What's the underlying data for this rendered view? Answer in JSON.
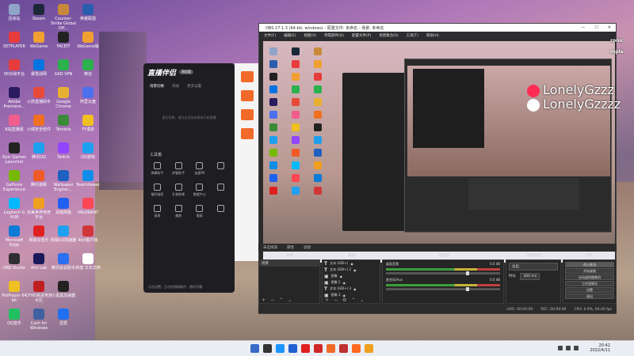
{
  "desktop": {
    "icons": [
      {
        "label": "回收站",
        "color": "#8fa4c8",
        "col": 0,
        "row": 0
      },
      {
        "label": "Steam",
        "color": "#1b2838",
        "col": 1,
        "row": 0
      },
      {
        "label": "Counter-Strike Global Off...",
        "color": "#c88a3a",
        "col": 2,
        "row": 0
      },
      {
        "label": "英雄联盟",
        "color": "#2a5db0",
        "col": 3,
        "row": 0
      },
      {
        "label": "5ETPLAYER",
        "color": "#e63c3c",
        "col": 0,
        "row": 1
      },
      {
        "label": "WeGame",
        "color": "#f0a030",
        "col": 1,
        "row": 1
      },
      {
        "label": "FACEIT",
        "color": "#222222",
        "col": 2,
        "row": 1
      },
      {
        "label": "WeGame版",
        "color": "#f0a030",
        "col": 3,
        "row": 1
      },
      {
        "label": "5E对战平台",
        "color": "#e63c3c",
        "col": 0,
        "row": 2
      },
      {
        "label": "暴雪战网",
        "color": "#0074e0",
        "col": 1,
        "row": 2
      },
      {
        "label": "GKD VPN",
        "color": "#2bb24c",
        "col": 2,
        "row": 2
      },
      {
        "label": "微信",
        "color": "#2bb24c",
        "col": 3,
        "row": 2
      },
      {
        "label": "Adobe Premiere...",
        "color": "#2a1a5e",
        "col": 0,
        "row": 3
      },
      {
        "label": "火箭直播助手",
        "color": "#e84a3a",
        "col": 1,
        "row": 3
      },
      {
        "label": "Google Chrome",
        "color": "#e8b030",
        "col": 2,
        "row": 3
      },
      {
        "label": "阿里云盘",
        "color": "#4a70f0",
        "col": 3,
        "row": 3
      },
      {
        "label": "B站直播姬",
        "color": "#f25d8e",
        "col": 0,
        "row": 4
      },
      {
        "label": "火绒安全软件",
        "color": "#f07020",
        "col": 1,
        "row": 4
      },
      {
        "label": "Terraria",
        "color": "#3a8a3a",
        "col": 2,
        "row": 4
      },
      {
        "label": "YY语音",
        "color": "#f0c020",
        "col": 3,
        "row": 4
      },
      {
        "label": "Epic Games Launcher",
        "color": "#222222",
        "col": 0,
        "row": 5
      },
      {
        "label": "腾讯QQ",
        "color": "#1ea0f0",
        "col": 1,
        "row": 5
      },
      {
        "label": "Twitch",
        "color": "#9146ff",
        "col": 2,
        "row": 5
      },
      {
        "label": "QQ游戏",
        "color": "#1ea0f0",
        "col": 3,
        "row": 5
      },
      {
        "label": "GeForce Experience",
        "color": "#76b900",
        "col": 0,
        "row": 6
      },
      {
        "label": "腾讯视频",
        "color": "#f05a28",
        "col": 1,
        "row": 6
      },
      {
        "label": "Wallpaper Engine:...",
        "color": "#2060c0",
        "col": 2,
        "row": 6
      },
      {
        "label": "TeamViewer",
        "color": "#0e8ee9",
        "col": 3,
        "row": 6
      },
      {
        "label": "Logitech G HUB",
        "color": "#00b8fc",
        "col": 0,
        "row": 7
      },
      {
        "label": "完美世界电竞平台",
        "color": "#f0a020",
        "col": 1,
        "row": 7
      },
      {
        "label": "百度网盘",
        "color": "#2060f0",
        "col": 2,
        "row": 7
      },
      {
        "label": "VALORANT",
        "color": "#ff4655",
        "col": 3,
        "row": 7
      },
      {
        "label": "Microsoft Edge",
        "color": "#0a7bd8",
        "col": 0,
        "row": 8
      },
      {
        "label": "网易云音乐",
        "color": "#e02020",
        "col": 1,
        "row": 8
      },
      {
        "label": "网易UU加速器",
        "color": "#20a0f0",
        "col": 2,
        "row": 8
      },
      {
        "label": "Riot客户端",
        "color": "#d13639",
        "col": 3,
        "row": 8
      },
      {
        "label": "OBS Studio",
        "color": "#302e31",
        "col": 0,
        "row": 9
      },
      {
        "label": "Aim Lab",
        "color": "#1a1a5a",
        "col": 1,
        "row": 9
      },
      {
        "label": "腾讯会议助手",
        "color": "#2a70f0",
        "col": 2,
        "row": 9
      },
      {
        "label": "新建 文本文档",
        "color": "#ffffff",
        "col": 3,
        "row": 9
      },
      {
        "label": "PotPlayer 64 bit",
        "color": "#f0c020",
        "col": 0,
        "row": 10
      },
      {
        "label": "CFHD高清竞技大区",
        "color": "#c02020",
        "col": 1,
        "row": 10
      },
      {
        "label": "小黑盒加速器",
        "color": "#222222",
        "col": 2,
        "row": 10
      },
      {
        "label": "QQ音乐",
        "color": "#20c060",
        "col": 0,
        "row": 11
      },
      {
        "label": "Cash for Windows",
        "color": "#4060a0",
        "col": 1,
        "row": 11
      },
      {
        "label": "迅雷",
        "color": "#2070f0",
        "col": 2,
        "row": 11
      }
    ]
  },
  "live_app": {
    "logo": "直播伴侣",
    "badge": "测试版",
    "tabs": [
      "场景切换",
      "添加",
      "更多设置"
    ],
    "empty_text": "暂无场景，请点击添加场景来开始直播",
    "tools_title": "工具箱",
    "tools": [
      "弹幕助手",
      "房管助手",
      "连麦PK",
      "",
      "福利抽奖",
      "礼物效果",
      "数据中心",
      "",
      "录屏",
      "美颜",
      "截屏",
      ""
    ],
    "footer": "点击设置，正在检测网络中，随时开播"
  },
  "obs": {
    "title": "OBS 27.1.3 (64-bit, windows) - 配置文件: 未命名 - 场景: 未命名",
    "menu": [
      "文件(F)",
      "编辑(E)",
      "视图(V)",
      "停靠部件(D)",
      "配置文件(P)",
      "场景集合(S)",
      "工具(T)",
      "帮助(H)"
    ],
    "tabs": [
      "未选择源",
      "属性",
      "滤镜"
    ],
    "docks": {
      "scenes_title": "场景",
      "sources_title": "来源",
      "mixer_title": "混音器",
      "transitions_title": "转场特效",
      "controls_title": "控件"
    },
    "scenes": [
      "场景"
    ],
    "sources": [
      {
        "type": "T",
        "label": "文本 (GDI+)"
      },
      {
        "type": "T",
        "label": "文本 (GDI+) 2"
      },
      {
        "type": "▣",
        "label": "图像"
      },
      {
        "type": "▣",
        "label": "图像 2"
      },
      {
        "type": "T",
        "label": "文本 (GDI+) 3"
      },
      {
        "type": "▣",
        "label": "图像 3"
      }
    ],
    "mixer": [
      {
        "name": "桌面音频",
        "db": "0.0 dB"
      },
      {
        "name": "麦克风/Aux",
        "db": "0.0 dB"
      }
    ],
    "transition": {
      "value": "淡出",
      "duration_label": "时长",
      "duration": "300 ms"
    },
    "controls": [
      "停止推流",
      "开始录制",
      "启动虚拟摄像机",
      "工作室模式",
      "设置",
      "退出"
    ],
    "status": [
      "LIVE: 00:00:00",
      "REC: 00:00:00",
      "CPU: 0.9%, 60.00 fps"
    ]
  },
  "overlay": {
    "line1": "LonelyGzzz",
    "line2": "LonelyGzzzz",
    "corner_top": "ronic",
    "corner_bottom": "mple"
  },
  "taskbar": {
    "time": "20:42",
    "date": "2022/4/11",
    "pins": [
      "#3a6ac8",
      "#333333",
      "#1d93ff",
      "#2060d0",
      "#e02020",
      "#d02828",
      "#f06a2a",
      "#c03030",
      "#ff6a20",
      "#f0a020"
    ]
  }
}
